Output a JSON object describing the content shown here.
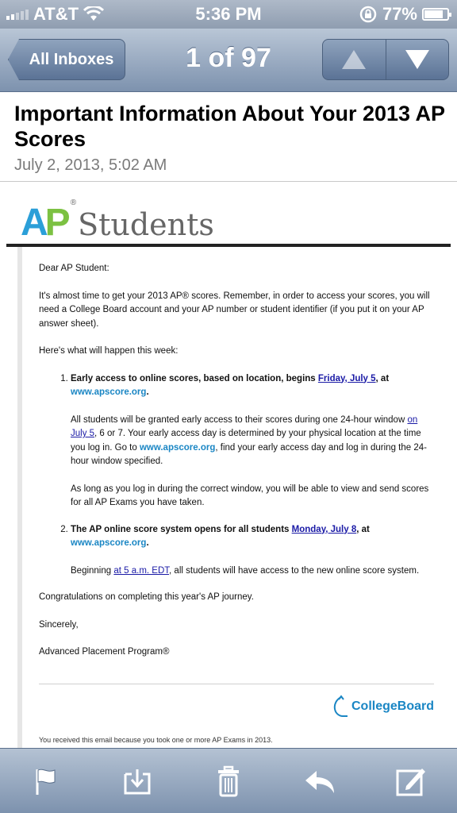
{
  "status_bar": {
    "carrier": "AT&T",
    "time": "5:36 PM",
    "battery_percent": "77%",
    "battery_level": 0.77
  },
  "nav": {
    "back_label": "All Inboxes",
    "position": "1 of 97"
  },
  "message": {
    "subject": "Important Information About Your 2013 AP Scores",
    "date": "July 2, 2013, 5:02 AM"
  },
  "email": {
    "logo_brand": "AP",
    "logo_reg": "®",
    "logo_students": "Students",
    "greeting": "Dear AP Student:",
    "intro": "It's almost time to get your 2013 AP® scores. Remember, in order to access your scores, you will need a College Board account and your AP number or student identifier (if you put it on your AP answer sheet).",
    "week_intro": "Here's what will happen this week:",
    "item1": {
      "heading": "Early access to online scores, based on location, begins ",
      "date_link": "Friday, July 5",
      "at": ", at",
      "site": "www.apscore.org",
      "period": ".",
      "p1_a": "All students will be granted early access to their scores during one 24-hour window ",
      "p1_link": "on July 5",
      "p1_b": ", 6 or 7. Your early access day is determined by your physical location at the time you log in. Go to ",
      "p1_site": "www.apscore.org",
      "p1_c": ", find your early access day and log in during the 24-hour window specified.",
      "p2": "As long as you log in during the correct window, you will be able to view and send scores for all AP Exams you have taken."
    },
    "item2": {
      "heading": "The AP online score system opens for all students ",
      "date_link": "Monday, July 8",
      "at": ", at",
      "site": "www.apscore.org",
      "period": ".",
      "p1_a": "Beginning ",
      "p1_link": "at 5 a.m. EDT",
      "p1_b": ", all students will have access to the new online score system."
    },
    "congrats": "Congratulations on completing this year's AP journey.",
    "signoff": "Sincerely,",
    "signature": "Advanced Placement Program®",
    "collegeboard": "CollegeBoard",
    "footer": "You received this email because you took one or more AP Exams in 2013."
  },
  "toolbar": {
    "icons": [
      "flag-icon",
      "move-to-folder-icon",
      "trash-icon",
      "reply-icon",
      "compose-icon"
    ]
  },
  "colors": {
    "ap_blue": "#2b9fd8",
    "ap_green": "#7cc142",
    "link_blue": "#1a1aa6",
    "site_blue": "#1a86c4",
    "nav_bar": "#8fa3bd"
  }
}
